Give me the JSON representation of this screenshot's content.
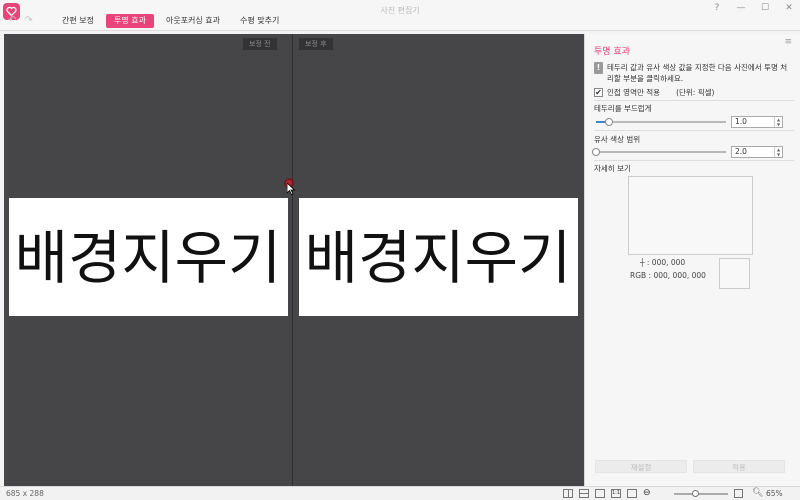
{
  "window": {
    "title": "사진 편집기",
    "help_label": "?"
  },
  "tabs": [
    {
      "label": "간편 보정",
      "active": false
    },
    {
      "label": "투명 효과",
      "active": true
    },
    {
      "label": "아웃포커싱 효과",
      "active": false
    },
    {
      "label": "수평 맞추기",
      "active": false
    }
  ],
  "canvas": {
    "before_label": "보정 전",
    "after_label": "보정 후",
    "image_text": "배경지우기"
  },
  "panel": {
    "title": "투명 효과",
    "info_line1": "테두리 값과 유사 색상 값을 지정한 다음 사진에서 투명 처",
    "info_line2": "리할 부분을 클릭하세요.",
    "adjacent_only_label": "인접 영역만 적용",
    "adjacent_only_checked": true,
    "unit_label": "(단위: 픽셀)",
    "feather_label": "테두리를 부드럽게",
    "feather_value": "1.0",
    "feather_level": 0.1,
    "similarity_label": "유사 색상 범위",
    "similarity_value": "2.0",
    "similarity_level": 0.0,
    "detail_label": "자세히 보기",
    "coord_label": "┼ : 000, 000",
    "rgb_label": "RGB : 000, 000, 000",
    "reset_label": "재설정",
    "apply_label": "적용"
  },
  "status": {
    "dimensions": "685 x 288",
    "zoom": "65%"
  },
  "colors": {
    "accent": "#e8437a",
    "canvas": "#464547"
  }
}
